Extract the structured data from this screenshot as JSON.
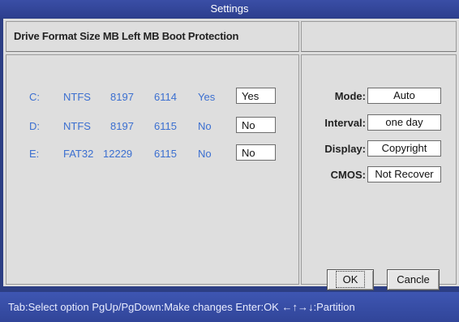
{
  "window": {
    "title": "Settings"
  },
  "drives": {
    "header": "Drive Format Size MB Left MB Boot Protection",
    "rows": [
      {
        "drive": "C:",
        "format": "NTFS",
        "size_mb": "8197",
        "left_mb": "6114",
        "boot": "Yes",
        "protection": "Yes"
      },
      {
        "drive": "D:",
        "format": "NTFS",
        "size_mb": "8197",
        "left_mb": "6115",
        "boot": "No",
        "protection": "No"
      },
      {
        "drive": "E:",
        "format": "FAT32",
        "size_mb": "12229",
        "left_mb": "6115",
        "boot": "No",
        "protection": "No"
      }
    ]
  },
  "options": {
    "mode_label": "Mode:",
    "mode_value": "Auto",
    "interval_label": "Interval:",
    "interval_value": "one day",
    "display_label": "Display:",
    "display_value": "Copyright",
    "cmos_label": "CMOS:",
    "cmos_value": "Not Recover"
  },
  "buttons": {
    "ok": "OK",
    "cancel": "Cancle"
  },
  "status": {
    "hint": "Tab:Select option  PgUp/PgDown:Make changes  Enter:OK  ←↑→↓:Partition"
  },
  "colors": {
    "title_bar": "#2d3f8e",
    "panel": "#dedede",
    "drive_text": "#3b6fd0",
    "status_bar": "#314599"
  }
}
